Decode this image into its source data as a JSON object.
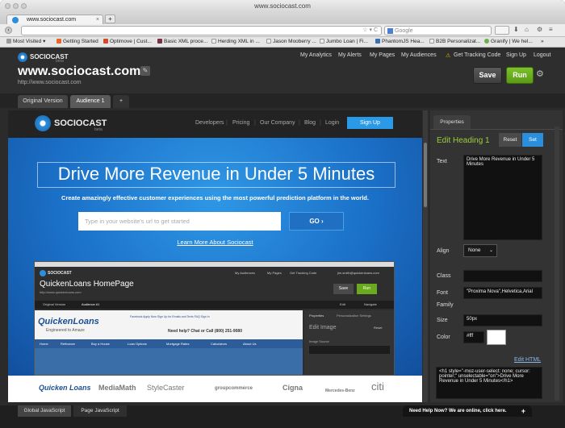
{
  "browser": {
    "window_title": "www.sociocast.com",
    "tab_title": "www.sociocast.com",
    "search_placeholder": "Google",
    "bookmarks": [
      "Most Visited",
      "Getting Started",
      "Optimove | Cust...",
      "Basic XML proce...",
      "Herding XML in ...",
      "Jason Mooberry ...",
      "Jumbo Loan | Fi...",
      "PhantomJS Hea...",
      "B2B Personalizat...",
      "Granify | We hel..."
    ]
  },
  "app": {
    "logo_text": "SOCIOCAST",
    "logo_sub": "beta",
    "site_title": "www.sociocast.com",
    "site_url": "http://www.sociocast.com",
    "top_links": [
      "My Analytics",
      "My Alerts",
      "My Pages",
      "My Audiences",
      "Get Tracking Code",
      "Sign Up",
      "Logout"
    ],
    "save_label": "Save",
    "run_label": "Run",
    "tabs": [
      "Original Version",
      "Audience 1"
    ],
    "add_tab": "+"
  },
  "site": {
    "logo_text": "SOCIOCAST",
    "logo_sub": "beta",
    "nav": [
      "Developers",
      "Pricing",
      "Our Company",
      "Blog",
      "Login"
    ],
    "signup": "Sign Up",
    "headline": "Drive More Revenue in Under 5 Minutes",
    "subhead": "Create amazingly effective customer experiences using the most powerful prediction platform in the world.",
    "input_placeholder": "Type in your website's url to get started",
    "go_label": "GO",
    "learn_more": "Learn More About Sociocast",
    "logos": [
      "Quicken Loans",
      "MediaMath",
      "StyleCaster",
      "groupcommerce",
      "Cigna",
      "Mercedes-Benz",
      "citi"
    ]
  },
  "mini": {
    "title": "QuickenLoans HomePage",
    "url": "http://www.quickenloans.com",
    "logo_text": "SOCIOCAST",
    "top_links": [
      "My Audiences",
      "My Pages",
      "Get Tracking Code",
      "jim.smith@quickenloans.com"
    ],
    "save_label": "Save",
    "run_label": "Run",
    "tabs": [
      "Original Version",
      "Audience #1"
    ],
    "ql_logo": "QuickenLoans",
    "ql_tagline": "Engineered to Amaze",
    "help_text": "Need help? Chat or Call (800) 251-9080",
    "ql_nav": [
      "Home",
      "Refinance",
      "Buy a House",
      "Loan Options",
      "Mortgage Rates",
      "Calculators",
      "About Us"
    ],
    "ql_toplinks": "Facebook  Apply Now  Sign Up for Emails and Texts  FAQ  Sign In",
    "panel_tabs": [
      "Properties",
      "Personalization Settings"
    ],
    "edit_label": "Edit Image",
    "reset_label": "Reset",
    "image_source": "Image Source",
    "edit_btn": "Edit",
    "navigate_btn": "Navigate"
  },
  "panel": {
    "tab": "Properties",
    "heading": "Edit Heading 1",
    "reset": "Reset",
    "set": "Set",
    "text_label": "Text",
    "text_value": "Drive More Revenue in Under 5 Minutes",
    "align_label": "Align",
    "align_value": "None",
    "class_label": "Class",
    "font_label": "Font",
    "family_label": "Family",
    "font_value": "\"Proxima Nova\",Helvetica,Arial",
    "size_label": "Size",
    "size_value": "50px",
    "color_label": "Color",
    "color_value": "#fff",
    "edit_html": "Edit HTML",
    "html_value": "<h1 style=\"-moz-user-select: none; cursor: pointer;\" unselectable=\"on\">Drive More Revenue in Under 5 Minutes</h1>"
  },
  "bottom": {
    "tabs": [
      "Global JavaScript",
      "Page JavaScript"
    ],
    "chat": "Need Help Now? We are online, click here.",
    "chat_plus": "+"
  },
  "colors": {
    "green": "#6aaa1e",
    "blue": "#2a8fdc",
    "dark": "#2e2e2e"
  }
}
